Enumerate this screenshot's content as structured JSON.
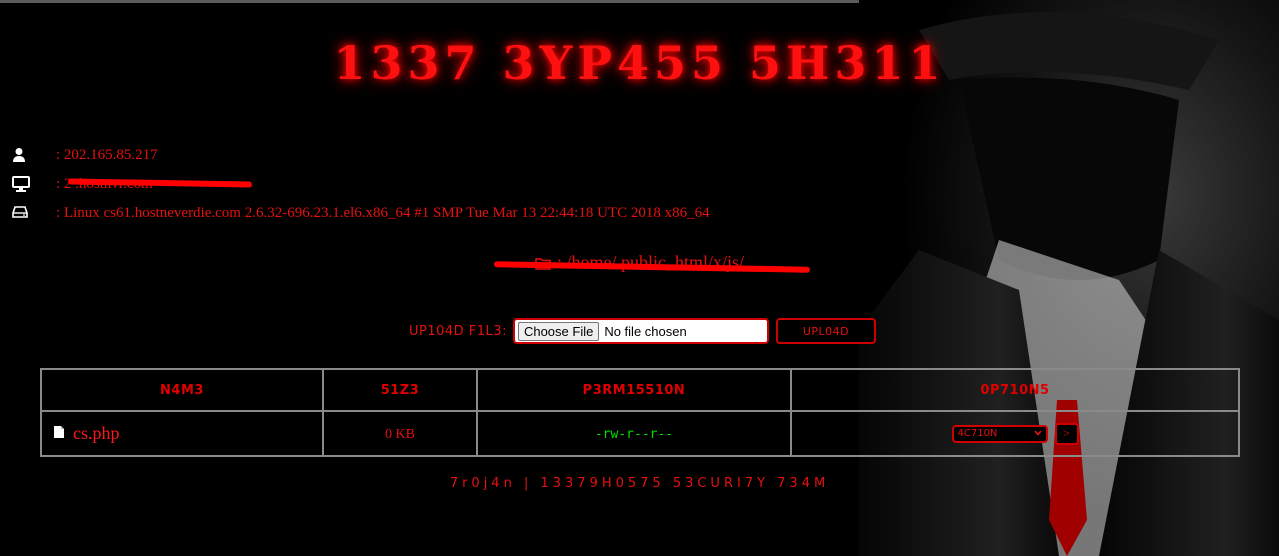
{
  "header": {
    "title": "1337 3YP455 5H311"
  },
  "info": [
    {
      "icon": "user-icon",
      "text": ": 202.165.85.217"
    },
    {
      "icon": "monitor-icon",
      "text": ": 2                    .hostnvr.com"
    },
    {
      "icon": "hard-drive-icon",
      "text": ": Linux cs61.hostneverdie.com 2.6.32-696.23.1.el6.x86_64 #1 SMP Tue Mar 13 22:44:18 UTC 2018 x86_64"
    }
  ],
  "path": {
    "icon": "folder-icon",
    "text": ": /home/                                               public_html/x/js/"
  },
  "upload": {
    "label": "UP104D F1L3:",
    "choose_label": "Choose File",
    "no_file": "No file chosen",
    "button": "UPL04D"
  },
  "table": {
    "headers": [
      "N4M3",
      "51Z3",
      "P3RM15510N",
      "0P710N5"
    ],
    "rows": [
      {
        "name": "cs.php",
        "size": "0 KB",
        "permission": "-rw-r--r--",
        "action": "4C710N",
        "go": ">"
      }
    ]
  },
  "footer": {
    "text": "7r0j4n | 13379H0575 53CURI7Y 734M"
  },
  "colors": {
    "accent": "#e61010",
    "permission": "#00e000",
    "border": "#8a8a8a",
    "background": "#000000"
  }
}
